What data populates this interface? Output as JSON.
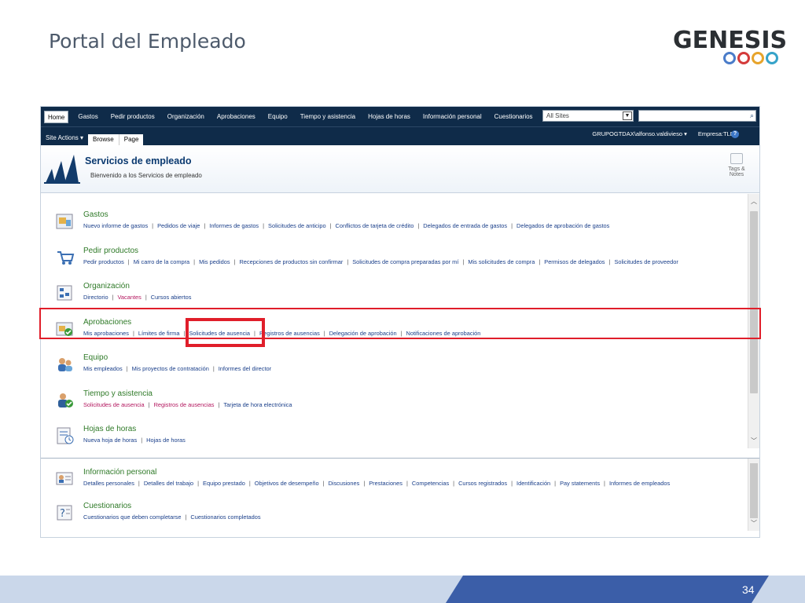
{
  "slide": {
    "title": "Portal del Empleado",
    "logo_text": "GENESIS",
    "page_number": "34"
  },
  "topnav": {
    "tabs": [
      "Home",
      "Gastos",
      "Pedir productos",
      "Organización",
      "Aprobaciones",
      "Equipo",
      "Tiempo y asistencia",
      "Hojas de horas",
      "Información personal",
      "Cuestionarios"
    ],
    "scope_value": "All Sites",
    "search_placeholder": ""
  },
  "ribbon": {
    "site_actions": "Site Actions ▾",
    "browse": "Browse",
    "page": "Page",
    "user": "GRUPOGTDAX\\alfonso.valdivieso ▾",
    "company": "Empresa:TLD ▿"
  },
  "header": {
    "title": "Servicios de empleado",
    "description": "Bienvenido a los Servicios de empleado",
    "tags_label_1": "Tags &",
    "tags_label_2": "Notes"
  },
  "sections": [
    {
      "title": "Gastos",
      "links": [
        "Nuevo informe de gastos",
        "Pedidos de viaje",
        "Informes de gastos",
        "Solicitudes de anticipo",
        "Conflictos de tarjeta de crédito",
        "Delegados de entrada de gastos",
        "Delegados de aprobación de gastos"
      ]
    },
    {
      "title": "Pedir productos",
      "links": [
        "Pedir productos",
        "Mi carro de la compra",
        "Mis pedidos",
        "Recepciones de productos sin confirmar",
        "Solicitudes de compra preparadas por mí",
        "Mis solicitudes de compra",
        "Permisos de delegados",
        "Solicitudes de proveedor"
      ]
    },
    {
      "title": "Organización",
      "links": [
        "Directorio",
        "Vacantes",
        "Cursos abiertos"
      ]
    },
    {
      "title": "Aprobaciones",
      "links": [
        "Mis aprobaciones",
        "Límites de firma",
        "Solicitudes de ausencia",
        "Registros de ausencias",
        "Delegación de aprobación",
        "Notificaciones de aprobación"
      ]
    },
    {
      "title": "Equipo",
      "links": [
        "Mis empleados",
        "Mis proyectos de contratación",
        "Informes del director"
      ]
    },
    {
      "title": "Tiempo y asistencia",
      "links": [
        "Solicitudes de ausencia",
        "Registros de ausencias",
        "Tarjeta de hora electrónica"
      ]
    },
    {
      "title": "Hojas de horas",
      "links": [
        "Nueva hoja de horas",
        "Hojas de horas"
      ]
    },
    {
      "title": "Información personal",
      "links": [
        "Detalles personales",
        "Detalles del trabajo",
        "Equipo prestado",
        "Objetivos de desempeño",
        "Discusiones",
        "Prestaciones",
        "Competencias",
        "Cursos registrados",
        "Identificación",
        "Pay statements",
        "Informes de empleados"
      ]
    },
    {
      "title": "Cuestionarios",
      "links": [
        "Cuestionarios que deben completarse",
        "Cuestionarios completados"
      ]
    }
  ],
  "colors": {
    "nav_bg": "#0f2b49",
    "section_title": "#2f7a28",
    "link": "#1a3f8a",
    "highlight": "#e01e2a"
  }
}
